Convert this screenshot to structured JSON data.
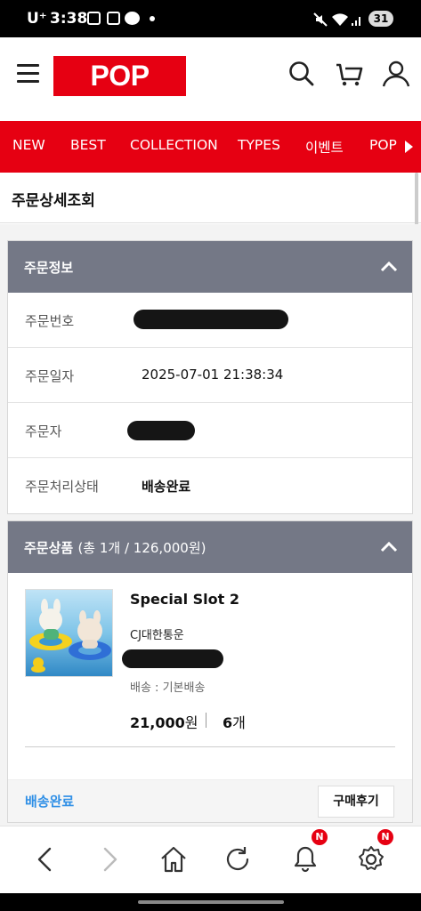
{
  "status_bar": {
    "carrier": "U⁺",
    "time": "3:38",
    "battery": "31"
  },
  "header": {
    "logo": "POP MART"
  },
  "nav": {
    "items": [
      "NEW",
      "BEST",
      "COLLECTION",
      "TYPES",
      "이벤트",
      "POP"
    ]
  },
  "page": {
    "title": "주문상세조회"
  },
  "order_info": {
    "title": "주문정보",
    "rows": [
      {
        "label": "주문번호",
        "value": ""
      },
      {
        "label": "주문일자",
        "value": "2025-07-01 21:38:34"
      },
      {
        "label": "주문자",
        "value": ""
      },
      {
        "label": "주문처리상태",
        "value": "배송완료"
      }
    ]
  },
  "order_items": {
    "title": "주문상품",
    "summary": "(총 1개 / 126,000원)",
    "product": {
      "name": "Special Slot 2",
      "courier": "CJ대한통운",
      "shipping": "배송 : 기본배송",
      "price": "21,000",
      "price_unit": "원",
      "qty": "6",
      "qty_unit": "개"
    },
    "status": "배송완료",
    "review_button": "구매후기"
  },
  "toolbar": {
    "badge": "N"
  }
}
